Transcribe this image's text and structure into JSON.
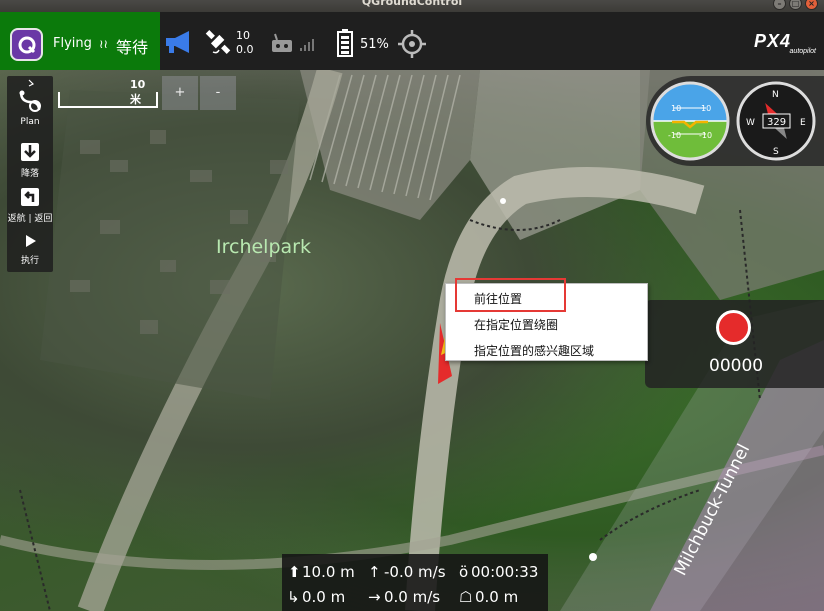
{
  "window": {
    "title": "QGroundControl"
  },
  "toolbar": {
    "flight_state": "Flying",
    "flight_mode": "等待",
    "satellites_count": "10",
    "satellites_hdop": "0.0",
    "battery_percent": "51%",
    "brand": "PX4",
    "brand_sub": "autopilot"
  },
  "map": {
    "scale_label": "10 米",
    "zoom_in": "+",
    "zoom_out": "-",
    "park_label": "Irchelpark",
    "tunnel_label": "Milchbuck-Tunnel"
  },
  "plan_panel": {
    "items": [
      {
        "label": "Plan",
        "icon": "plan-icon"
      },
      {
        "label": "降落",
        "icon": "land-icon"
      },
      {
        "label": "返航 | 返回",
        "icon": "rtl-icon"
      },
      {
        "label": "执行",
        "icon": "play-icon"
      }
    ]
  },
  "instruments": {
    "heading": "329",
    "pitch_up": "10",
    "pitch_down": "-10",
    "compass_n": "N",
    "compass_s": "S",
    "compass_e": "E",
    "compass_w": "W"
  },
  "context_menu": {
    "items": [
      "前往位置",
      "在指定位置绕圈",
      "指定位置的感兴趣区域"
    ]
  },
  "video": {
    "record_counter": "00000"
  },
  "telemetry": {
    "altitude": "10.0 m",
    "vertical_speed": "-0.0 m/s",
    "flight_time": "00:00:33",
    "distance": "0.0 m",
    "ground_speed": "0.0 m/s",
    "distance_home": "0.0 m"
  },
  "colors": {
    "toolbar_green": "#0b7a0b",
    "record_red": "#e52b2b",
    "highlight_red": "#e53935",
    "logo_purple": "#6a38a6"
  }
}
